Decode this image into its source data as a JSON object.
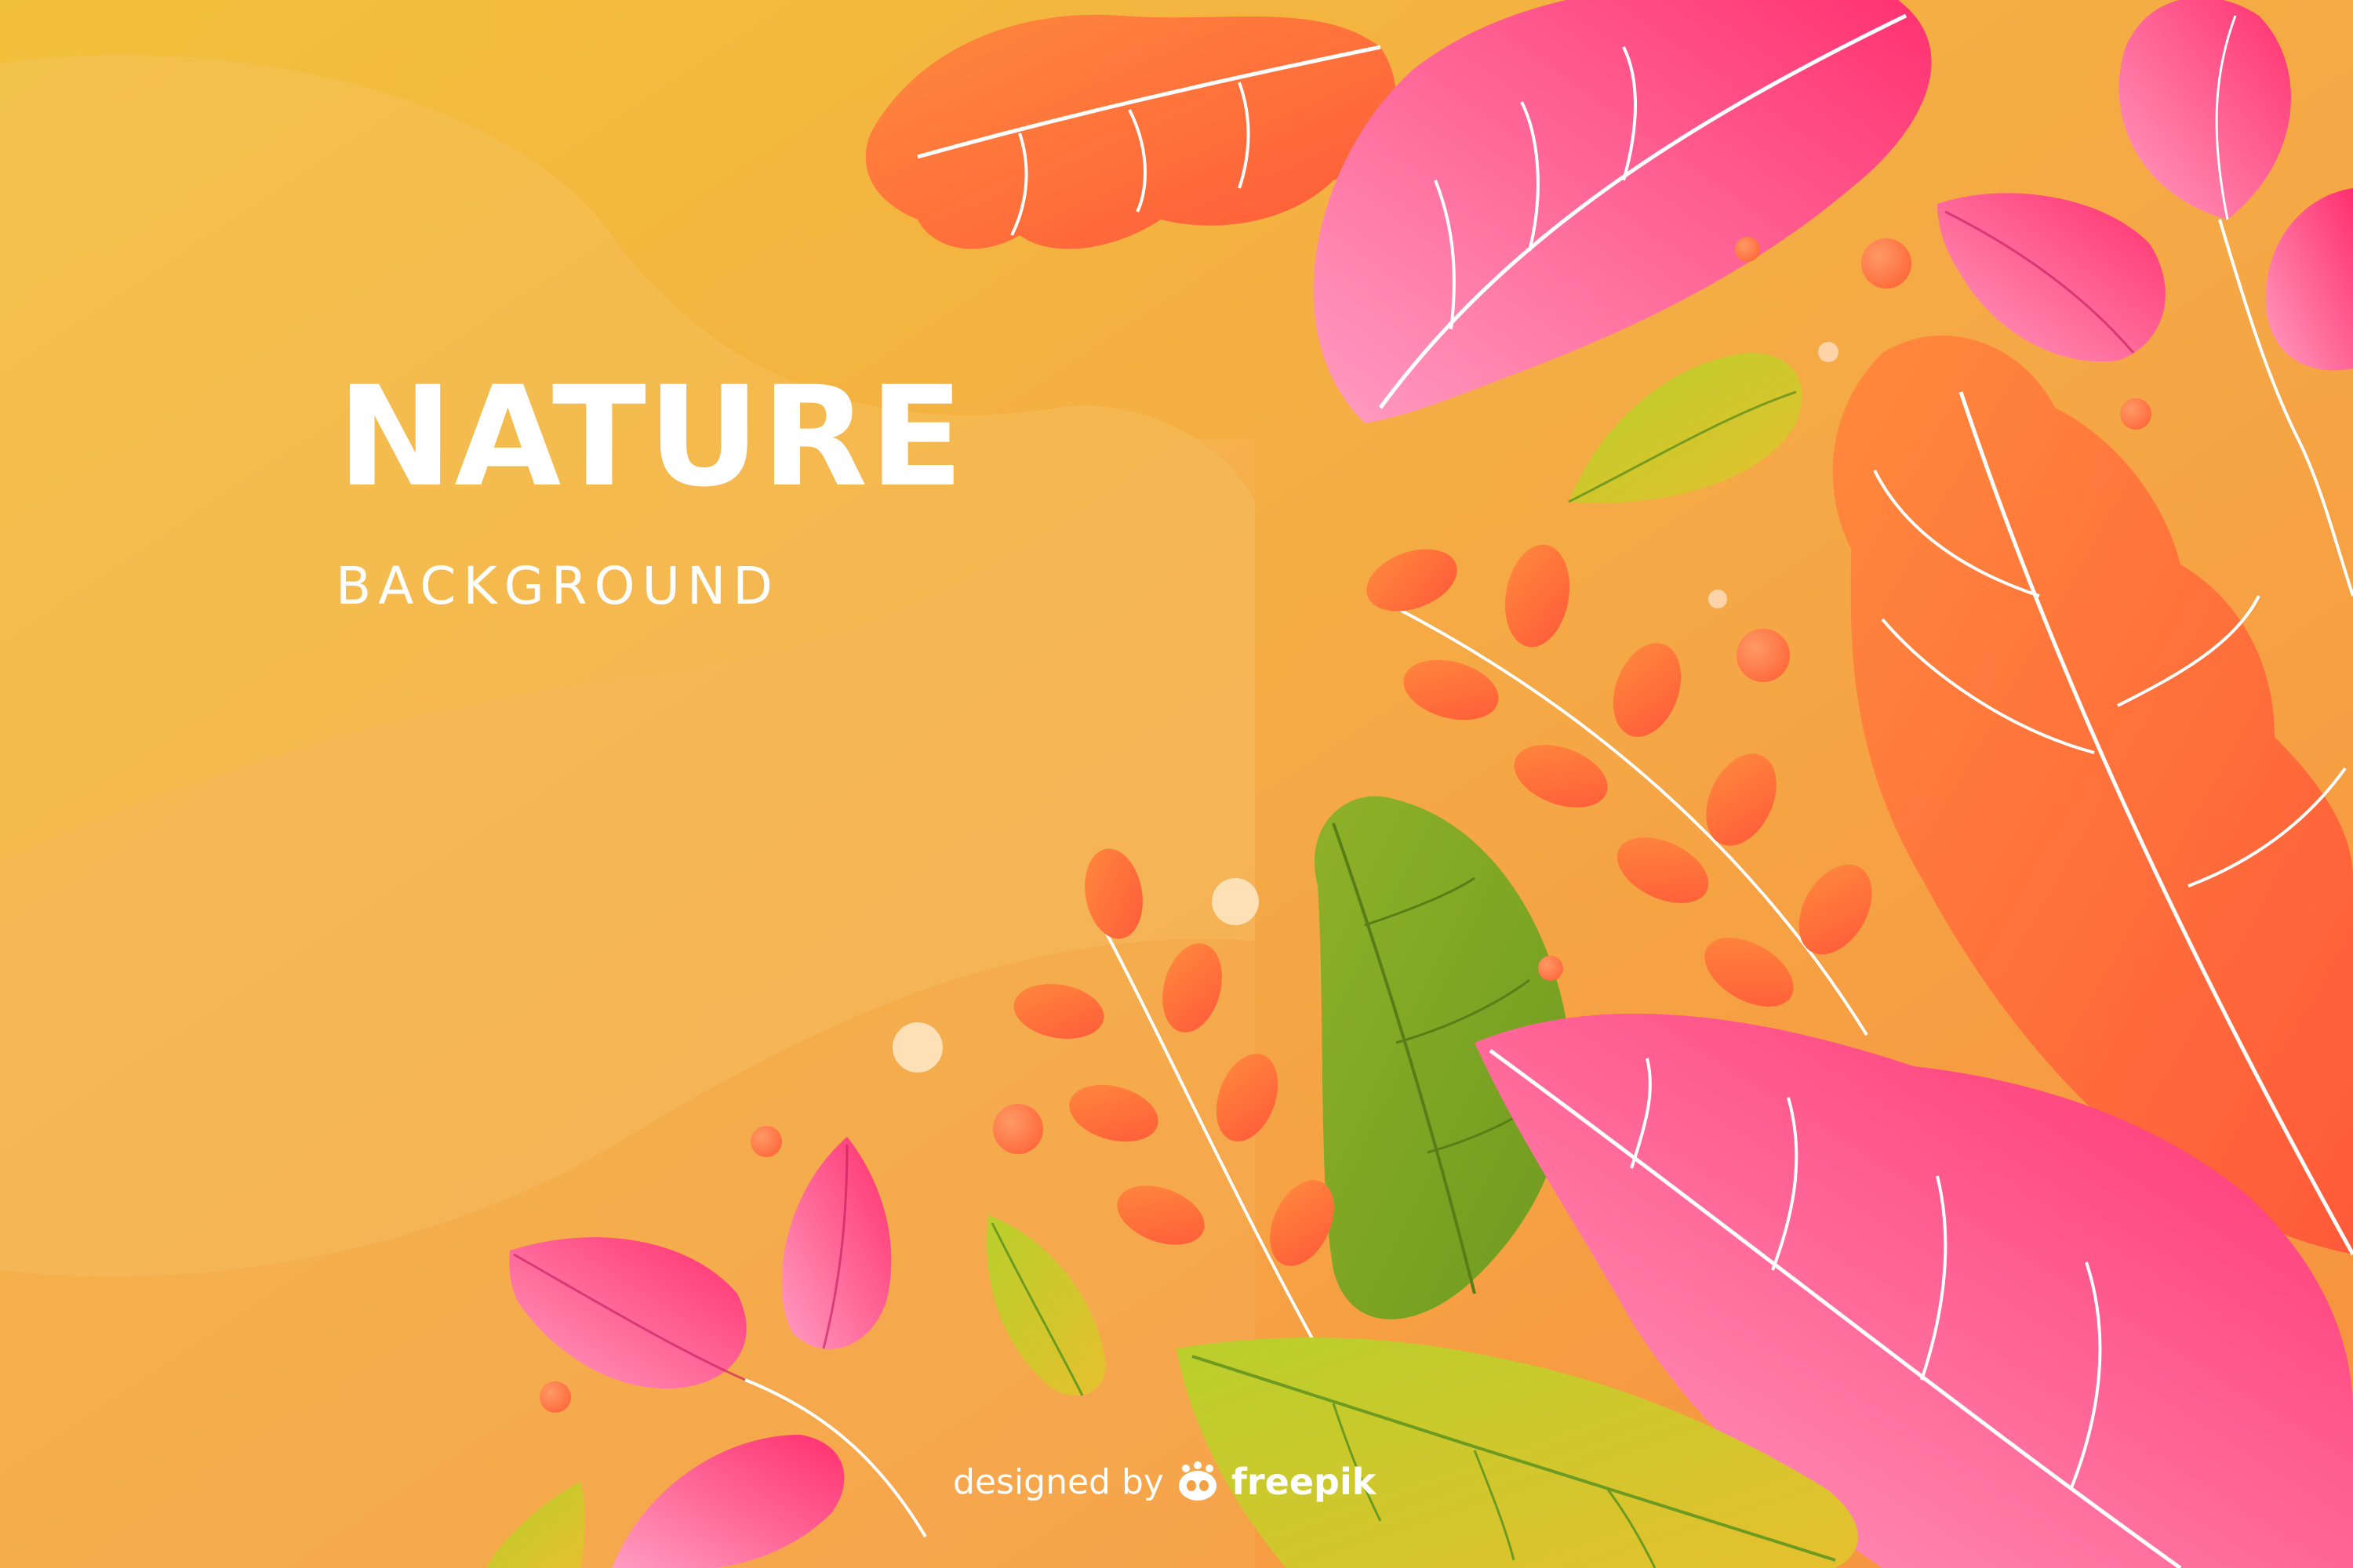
{
  "heading": {
    "title": "NATURE",
    "subtitle": "BACKGROUND"
  },
  "credit": {
    "prefix": "designed by",
    "brand": "freepik",
    "icon": "freepik-logo-icon"
  },
  "colors": {
    "background_yellow": "#f2c13a",
    "background_orange": "#f7a043",
    "leaf_pink": "#ff3d7a",
    "leaf_light_pink": "#ff8fb1",
    "leaf_orange": "#ff6b3d",
    "leaf_green": "#a8c226",
    "text": "#ffffff"
  }
}
